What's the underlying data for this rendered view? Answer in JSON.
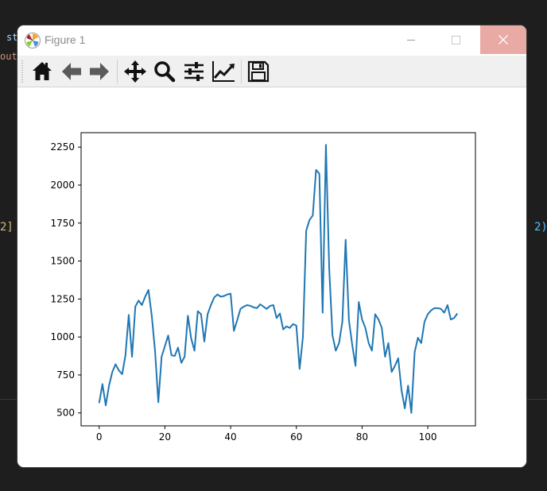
{
  "window": {
    "title": "Figure 1"
  },
  "background": {
    "fragments": [
      {
        "text": "st",
        "color": "#9cdcfe"
      },
      {
        "text": "out",
        "color": "#ce9178"
      },
      {
        "text": "2]",
        "color": "#d7ba7d"
      },
      {
        "text": "2)",
        "color": "#4fc1ff"
      }
    ]
  },
  "toolbar": {
    "buttons": [
      {
        "name": "home-button",
        "icon": "home-icon"
      },
      {
        "name": "back-button",
        "icon": "arrow-left-icon"
      },
      {
        "name": "forward-button",
        "icon": "arrow-right-icon"
      },
      {
        "name": "pan-button",
        "icon": "move-icon"
      },
      {
        "name": "zoom-button",
        "icon": "magnifier-icon"
      },
      {
        "name": "configure-subplots-button",
        "icon": "sliders-icon"
      },
      {
        "name": "edit-axis-button",
        "icon": "line-chart-icon"
      },
      {
        "name": "save-button",
        "icon": "floppy-disk-icon"
      }
    ]
  },
  "chart_data": {
    "type": "line",
    "title": "",
    "xlabel": "",
    "ylabel": "",
    "xlim": [
      -5.5,
      114.5
    ],
    "ylim": [
      415,
      2345
    ],
    "xticks": [
      0,
      20,
      40,
      60,
      80,
      100
    ],
    "yticks": [
      500,
      750,
      1000,
      1250,
      1500,
      1750,
      2000,
      2250
    ],
    "grid": false,
    "legend": null,
    "series": [
      {
        "color": "#1f77b4",
        "x": [
          0,
          1,
          2,
          3,
          4,
          5,
          6,
          7,
          8,
          9,
          10,
          11,
          12,
          13,
          14,
          15,
          16,
          17,
          18,
          19,
          20,
          21,
          22,
          23,
          24,
          25,
          26,
          27,
          28,
          29,
          30,
          31,
          32,
          33,
          34,
          35,
          36,
          37,
          38,
          39,
          40,
          41,
          42,
          43,
          44,
          45,
          46,
          47,
          48,
          49,
          50,
          51,
          52,
          53,
          54,
          55,
          56,
          57,
          58,
          59,
          60,
          61,
          62,
          63,
          64,
          65,
          66,
          67,
          68,
          69,
          70,
          71,
          72,
          73,
          74,
          75,
          76,
          77,
          78,
          79,
          80,
          81,
          82,
          83,
          84,
          85,
          86,
          87,
          88,
          89,
          90,
          91,
          92,
          93,
          94,
          95,
          96,
          97,
          98,
          99,
          100,
          101,
          102,
          103,
          104,
          105,
          106,
          107,
          108,
          109
        ],
        "values": [
          565,
          690,
          550,
          680,
          770,
          820,
          780,
          755,
          880,
          1145,
          870,
          1200,
          1240,
          1210,
          1265,
          1310,
          1140,
          910,
          570,
          870,
          940,
          1010,
          880,
          875,
          930,
          830,
          870,
          1140,
          990,
          910,
          1170,
          1150,
          970,
          1150,
          1210,
          1260,
          1280,
          1265,
          1270,
          1280,
          1285,
          1040,
          1110,
          1185,
          1200,
          1210,
          1205,
          1195,
          1190,
          1215,
          1200,
          1185,
          1205,
          1210,
          1125,
          1155,
          1050,
          1070,
          1060,
          1085,
          1075,
          790,
          1000,
          1700,
          1770,
          1800,
          2100,
          2075,
          1160,
          2265,
          1450,
          1010,
          910,
          960,
          1100,
          1640,
          1110,
          950,
          810,
          1230,
          1115,
          1060,
          960,
          910,
          1150,
          1115,
          1060,
          870,
          960,
          770,
          810,
          860,
          650,
          530,
          680,
          500,
          900,
          995,
          960,
          1100,
          1150,
          1175,
          1190,
          1190,
          1185,
          1160,
          1210,
          1115,
          1125,
          1155
        ]
      }
    ]
  }
}
